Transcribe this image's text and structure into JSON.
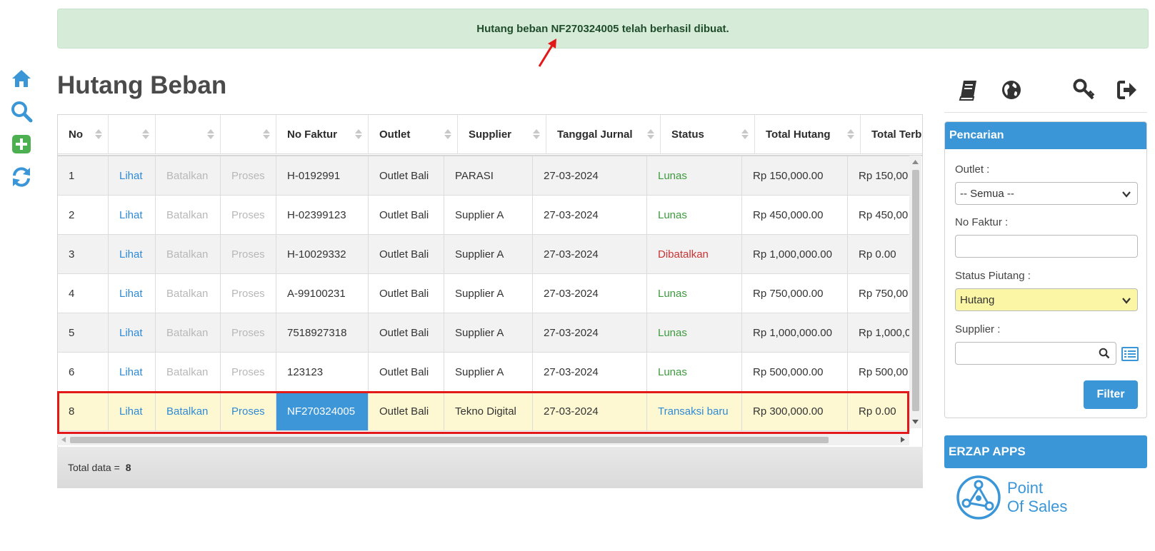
{
  "alert": {
    "message": "Hutang beban NF270324005 telah berhasil dibuat."
  },
  "page": {
    "title": "Hutang Beban"
  },
  "table": {
    "columns": [
      {
        "key": "no",
        "label": "No",
        "width": 71
      },
      {
        "key": "view",
        "label": "",
        "width": 66
      },
      {
        "key": "cancel",
        "label": "",
        "width": 91
      },
      {
        "key": "process",
        "label": "",
        "width": 78
      },
      {
        "key": "invoice",
        "label": "No Faktur",
        "width": 129
      },
      {
        "key": "outlet",
        "label": "Outlet",
        "width": 125
      },
      {
        "key": "supplier",
        "label": "Supplier",
        "width": 124
      },
      {
        "key": "date",
        "label": "Tanggal Jurnal",
        "width": 160
      },
      {
        "key": "status",
        "label": "Status",
        "width": 132
      },
      {
        "key": "total",
        "label": "Total Hutang",
        "width": 148
      },
      {
        "key": "paid",
        "label": "Total Terb",
        "width": 120
      }
    ],
    "body_widths": [
      71,
      66,
      91,
      78,
      129,
      106,
      124,
      160,
      133,
      148,
      120
    ],
    "rows": [
      {
        "no": "1",
        "view": "Lihat",
        "cancel": "Batalkan",
        "process": "Proses",
        "invoice": "H-0192991",
        "outlet": "Outlet Bali",
        "supplier": "PARASI",
        "date": "27-03-2024",
        "status": "Lunas",
        "status_type": "paid",
        "total": "Rp 150,000.00",
        "paid": "Rp 150,00",
        "active": false
      },
      {
        "no": "2",
        "view": "Lihat",
        "cancel": "Batalkan",
        "process": "Proses",
        "invoice": "H-02399123",
        "outlet": "Outlet Bali",
        "supplier": "Supplier A",
        "date": "27-03-2024",
        "status": "Lunas",
        "status_type": "paid",
        "total": "Rp 450,000.00",
        "paid": "Rp 450,00",
        "active": false
      },
      {
        "no": "3",
        "view": "Lihat",
        "cancel": "Batalkan",
        "process": "Proses",
        "invoice": "H-10029332",
        "outlet": "Outlet Bali",
        "supplier": "Supplier A",
        "date": "27-03-2024",
        "status": "Dibatalkan",
        "status_type": "cancelled",
        "total": "Rp 1,000,000.00",
        "paid": "Rp 0.00",
        "active": false
      },
      {
        "no": "4",
        "view": "Lihat",
        "cancel": "Batalkan",
        "process": "Proses",
        "invoice": "A-99100231",
        "outlet": "Outlet Bali",
        "supplier": "Supplier A",
        "date": "27-03-2024",
        "status": "Lunas",
        "status_type": "paid",
        "total": "Rp 750,000.00",
        "paid": "Rp 750,00",
        "active": false
      },
      {
        "no": "5",
        "view": "Lihat",
        "cancel": "Batalkan",
        "process": "Proses",
        "invoice": "7518927318",
        "outlet": "Outlet Bali",
        "supplier": "Supplier A",
        "date": "27-03-2024",
        "status": "Lunas",
        "status_type": "paid",
        "total": "Rp 1,000,000.00",
        "paid": "Rp 1,000,0",
        "active": false
      },
      {
        "no": "6",
        "view": "Lihat",
        "cancel": "Batalkan",
        "process": "Proses",
        "invoice": "123123",
        "outlet": "Outlet Bali",
        "supplier": "Supplier A",
        "date": "27-03-2024",
        "status": "Lunas",
        "status_type": "paid",
        "total": "Rp 500,000.00",
        "paid": "Rp 500,00",
        "active": false
      },
      {
        "no": "8",
        "view": "Lihat",
        "cancel": "Batalkan",
        "process": "Proses",
        "invoice": "NF270324005",
        "outlet": "Outlet Bali",
        "supplier": "Tekno Digital",
        "date": "27-03-2024",
        "status": "Transaksi baru",
        "status_type": "new",
        "total": "Rp 300,000.00",
        "paid": "Rp 0.00",
        "active": true
      }
    ],
    "footer": {
      "label": "Total data =",
      "count": "8"
    }
  },
  "search_panel": {
    "title": "Pencarian",
    "outlet_label": "Outlet :",
    "outlet_value": "-- Semua --",
    "invoice_label": "No Faktur :",
    "invoice_value": "",
    "status_label": "Status Piutang :",
    "status_value": "Hutang",
    "supplier_label": "Supplier :",
    "supplier_value": "",
    "filter_label": "Filter"
  },
  "apps": {
    "title": "ERZAP APPS",
    "logo_line1": "Point",
    "logo_line2": "Of Sales"
  },
  "icons": {
    "left": [
      "home-icon",
      "search-icon",
      "add-icon",
      "refresh-icon"
    ],
    "top": [
      "book-icon",
      "globe-icon",
      "key-icon",
      "logout-icon"
    ]
  },
  "colors": {
    "accent": "#3a96d6",
    "success_bg": "#d6ecd9",
    "success_text": "#1f4d2a",
    "status_paid": "#3d9a3d",
    "status_cancelled": "#cc3333",
    "status_new": "#2f8ad6",
    "selected_row": "#fdf8d2",
    "highlight_outline": "#e31818"
  }
}
